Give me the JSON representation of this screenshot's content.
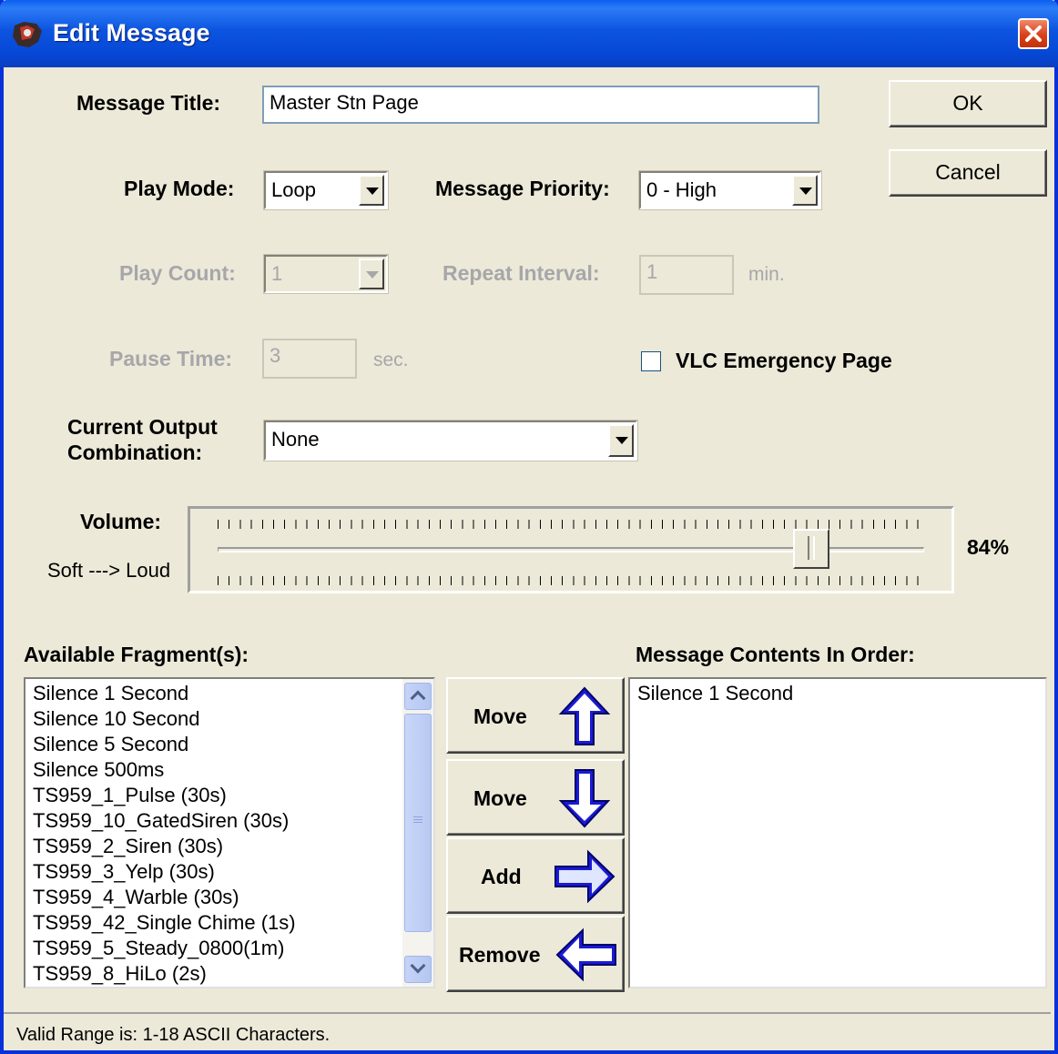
{
  "window": {
    "title": "Edit Message"
  },
  "fields": {
    "message_title_label": "Message Title:",
    "message_title_value": "Master Stn Page",
    "play_mode_label": "Play Mode:",
    "play_mode_value": "Loop",
    "message_priority_label": "Message Priority:",
    "message_priority_value": "0 - High",
    "play_count_label": "Play Count:",
    "play_count_value": "1",
    "repeat_interval_label": "Repeat Interval:",
    "repeat_interval_value": "1",
    "repeat_interval_unit": "min.",
    "pause_time_label": "Pause Time:",
    "pause_time_value": "3",
    "pause_time_unit": "sec.",
    "vlc_emergency_label": "VLC Emergency Page",
    "vlc_emergency_checked": false,
    "output_combo_label_1": "Current Output",
    "output_combo_label_2": "Combination:",
    "output_combo_value": "None"
  },
  "buttons": {
    "ok": "OK",
    "cancel": "Cancel"
  },
  "volume": {
    "label": "Volume:",
    "sublabel": "Soft ---> Loud",
    "value": 84,
    "value_text": "84%"
  },
  "available": {
    "label": "Available Fragment(s):",
    "items": [
      "Silence 1 Second",
      "Silence 10 Second",
      "Silence 5 Second",
      "Silence 500ms",
      "TS959_1_Pulse (30s)",
      "TS959_10_GatedSiren (30s)",
      "TS959_2_Siren (30s)",
      "TS959_3_Yelp (30s)",
      "TS959_4_Warble (30s)",
      "TS959_42_Single Chime (1s)",
      "TS959_5_Steady_0800(1m)",
      "TS959_8_HiLo (2s)"
    ]
  },
  "contents": {
    "label": "Message Contents In Order:",
    "items": [
      "Silence 1 Second"
    ]
  },
  "actions": {
    "move_up": "Move",
    "move_down": "Move",
    "add": "Add",
    "remove": "Remove"
  },
  "status": {
    "text": "Valid Range is: 1-18 ASCII Characters."
  }
}
